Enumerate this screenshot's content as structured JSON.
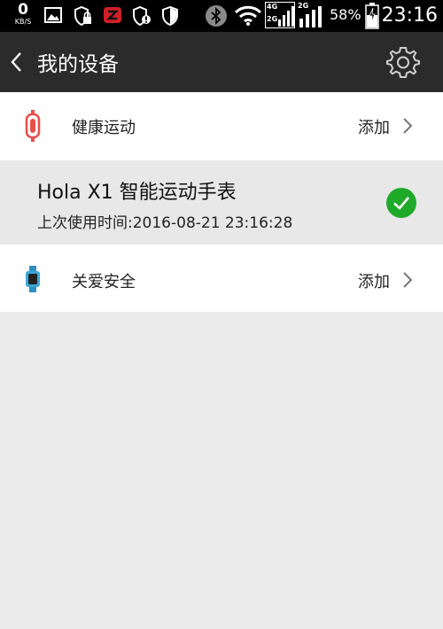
{
  "status_bar": {
    "speed_value": "0",
    "speed_unit": "KB/S",
    "network_4g": "4G",
    "network_2g_a": "2G",
    "network_2g_b": "2G",
    "battery_percent": "58%",
    "time": "23:16",
    "icons": [
      "image-icon",
      "shield-lock-icon",
      "app-z-icon",
      "shield-alert-icon",
      "shield-icon",
      "bluetooth-icon",
      "wifi-icon",
      "signal-icon",
      "battery-charging-icon"
    ]
  },
  "header": {
    "title": "我的设备",
    "back_icon": "chevron-left-icon",
    "settings_icon": "gear-icon"
  },
  "devices": {
    "health": {
      "label": "健康运动",
      "action": "添加",
      "icon": "band-icon",
      "icon_color": "#e8504a"
    },
    "watch": {
      "name": "Hola X1 智能运动手表",
      "last_used": "上次使用时间:2016-08-21 23:16:28",
      "status_icon": "check-circle-icon",
      "status_color": "#1faa2a"
    },
    "safety": {
      "label": "关爱安全",
      "action": "添加",
      "icon": "watch-icon",
      "icon_color": "#3ba7d8"
    }
  }
}
